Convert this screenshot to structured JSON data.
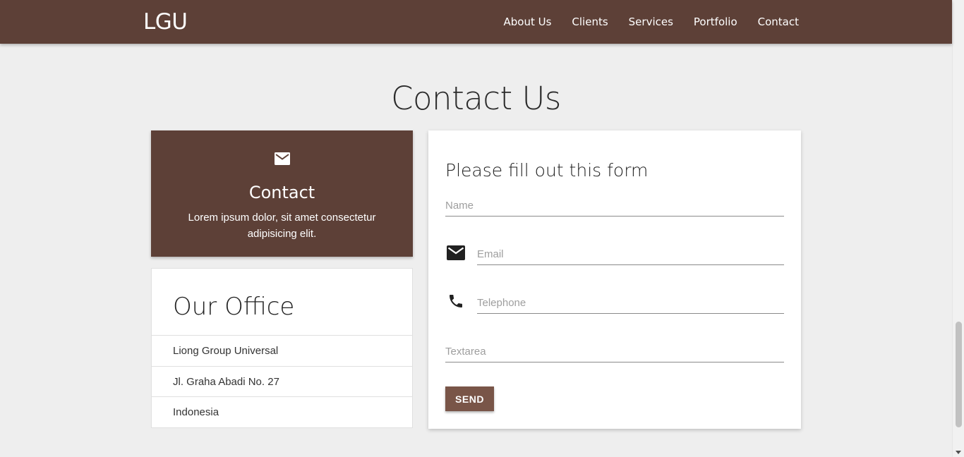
{
  "navbar": {
    "brand": "LGU",
    "links": [
      "About Us",
      "Clients",
      "Services",
      "Portfolio",
      "Contact"
    ]
  },
  "section": {
    "title": "Contact Us"
  },
  "contact_card": {
    "icon": "mail-icon",
    "title": "Contact",
    "text": "Lorem ipsum dolor, sit amet consectetur adipisicing elit."
  },
  "office": {
    "title": "Our Office",
    "items": [
      "Liong Group Universal",
      "Jl. Graha Abadi No. 27",
      "Indonesia"
    ]
  },
  "form": {
    "title": "Please fill out this form",
    "name_placeholder": "Name",
    "email_placeholder": "Email",
    "email_icon": "mail-icon",
    "telephone_placeholder": "Telephone",
    "telephone_icon": "phone-icon",
    "textarea_placeholder": "Textarea",
    "send_label": "SEND"
  },
  "colors": {
    "primary": "#5d4037",
    "button": "#795548",
    "background": "#eeeeee"
  }
}
